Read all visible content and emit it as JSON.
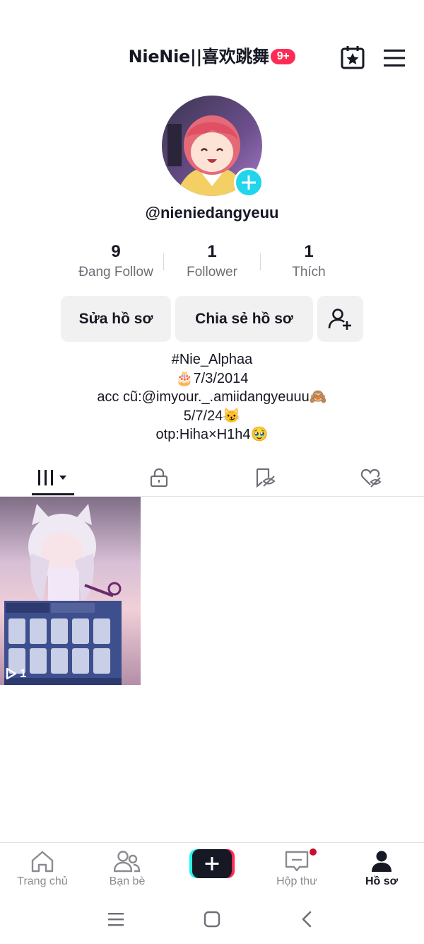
{
  "header": {
    "title": "NieNie||喜欢跳舞",
    "badge": "9+"
  },
  "profile": {
    "username": "@nieniedangyeuu"
  },
  "stats": [
    {
      "value": "9",
      "label": "Đang Follow"
    },
    {
      "value": "1",
      "label": "Follower"
    },
    {
      "value": "1",
      "label": "Thích"
    }
  ],
  "buttons": {
    "edit": "Sửa hồ sơ",
    "share": "Chia sẻ hồ sơ"
  },
  "bio": [
    "#Nie_Alphaa",
    "🎂7/3/2014",
    "acc cũ:@imyour._.amiidangyeuuu🙈",
    "5/7/24😼",
    "otp:Hiha×H1h4🥹"
  ],
  "video": {
    "views": "1"
  },
  "nav": [
    {
      "label": "Trang chủ"
    },
    {
      "label": "Bạn bè"
    },
    {
      "label": ""
    },
    {
      "label": "Hộp thư"
    },
    {
      "label": "Hồ sơ"
    }
  ],
  "colors": {
    "accent": "#fe2c55",
    "teal": "#20d5ec",
    "text": "#161823",
    "muted": "#6e6f76"
  }
}
